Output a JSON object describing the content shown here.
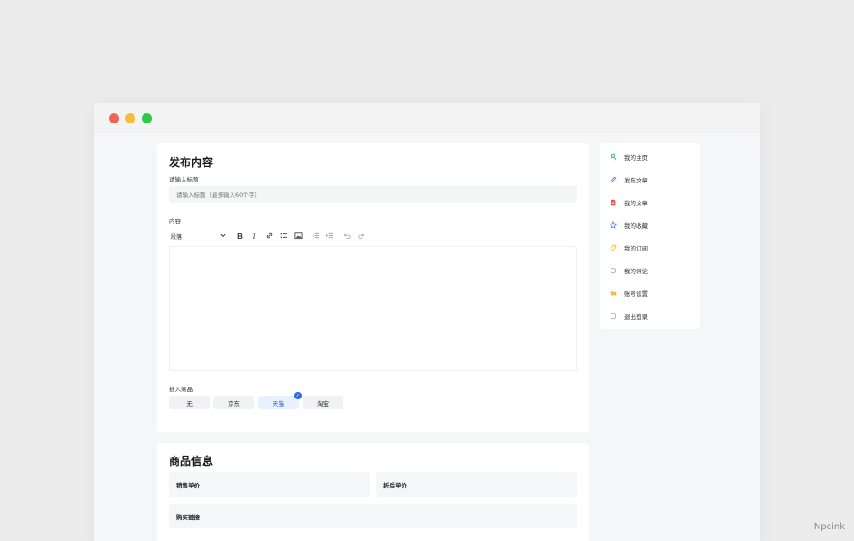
{
  "window": {
    "controls": [
      "close",
      "minimize",
      "maximize"
    ]
  },
  "publish": {
    "heading": "发布内容",
    "title_label": "请输入标题",
    "title_placeholder": "请输入标题（最多输入60个字）",
    "content_label": "内容",
    "toolbar": {
      "paragraph": "段落",
      "tools": [
        "chevron-down-icon",
        "bold-icon",
        "italic-icon",
        "link-icon",
        "bullet-list-icon",
        "image-icon",
        "outdent-icon",
        "indent-icon",
        "undo-icon",
        "redo-icon"
      ]
    },
    "insert_label": "插入商品",
    "options": [
      {
        "label": "无",
        "selected": false
      },
      {
        "label": "京东",
        "selected": false
      },
      {
        "label": "天猫",
        "selected": true
      },
      {
        "label": "淘宝",
        "selected": false
      }
    ]
  },
  "goods": {
    "heading": "商品信息",
    "sale_price": "销售单价",
    "discount_price": "折后单价",
    "buy_link": "购买链接"
  },
  "menu": {
    "items": [
      {
        "label": "我的主页",
        "icon": "user-icon",
        "color": "#2bb673"
      },
      {
        "label": "发布文章",
        "icon": "pencil-icon",
        "color": "#3d7bf0"
      },
      {
        "label": "我的文章",
        "icon": "document-icon",
        "color": "#f0524f"
      },
      {
        "label": "我的收藏",
        "icon": "star-icon",
        "color": "#3d7bf0"
      },
      {
        "label": "我的订阅",
        "icon": "tag-icon",
        "color": "#f5bd3a"
      },
      {
        "label": "我的评论",
        "icon": "comment-icon",
        "color": "#999999"
      },
      {
        "label": "账号设置",
        "icon": "folder-icon",
        "color": "#f5bd3a"
      },
      {
        "label": "退出登录",
        "icon": "logout-icon",
        "color": "#999999"
      }
    ]
  },
  "watermark": "Npcink",
  "colors": {
    "accent": "#2c6be6",
    "background": "#ececec"
  }
}
